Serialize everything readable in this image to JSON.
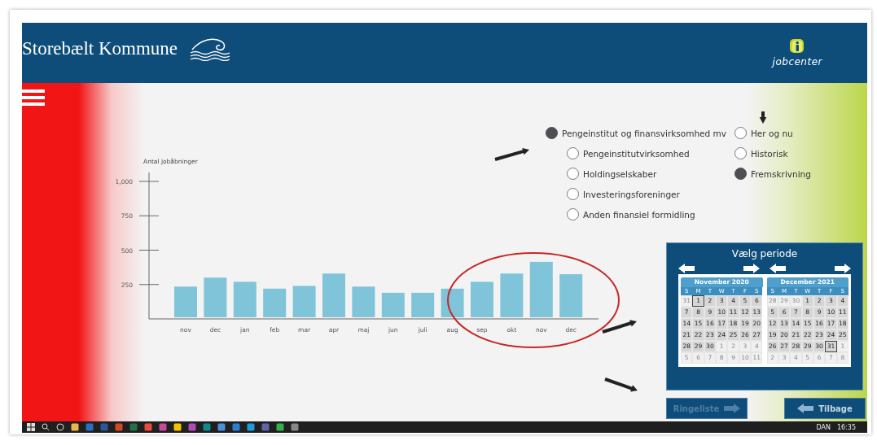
{
  "header": {
    "title": "Storebælt Kommune",
    "logo_text": "jobcenter"
  },
  "industry_options": [
    {
      "label": "Pengeinstitut og finansvirksomhed mv",
      "selected": true,
      "children": [
        {
          "label": "Pengeinstitutvirksomhed",
          "selected": false
        },
        {
          "label": "Holdingselskaber",
          "selected": false
        },
        {
          "label": "Investeringsforeninger",
          "selected": false
        },
        {
          "label": "Anden finansiel formidling",
          "selected": false
        }
      ]
    }
  ],
  "period_options": [
    {
      "label": "Her og nu",
      "selected": false
    },
    {
      "label": "Historisk",
      "selected": false
    },
    {
      "label": "Fremskrivning",
      "selected": true
    }
  ],
  "chart": {
    "chart_data": {
      "type": "bar",
      "ylabel": "Antal jobåbninger",
      "categories": [
        "nov",
        "dec",
        "jan",
        "feb",
        "mar",
        "apr",
        "maj",
        "jun",
        "juli",
        "aug",
        "sep",
        "okt",
        "nov",
        "dec"
      ],
      "values": [
        235,
        300,
        270,
        220,
        240,
        330,
        235,
        190,
        190,
        220,
        270,
        330,
        415,
        325
      ],
      "ylim": [
        0,
        1000
      ],
      "yticks": [
        {
          "value": 250,
          "label": "250"
        },
        {
          "value": 500,
          "label": "500"
        },
        {
          "value": 750,
          "label": "750"
        },
        {
          "value": 1000,
          "label": "1,000"
        }
      ]
    }
  },
  "period_picker": {
    "title": "Vælg periode",
    "calendars": [
      {
        "title": "November 2020",
        "weekdays": [
          "S",
          "M",
          "T",
          "W",
          "T",
          "F",
          "S"
        ],
        "days": [
          {
            "day": "31",
            "outside": true,
            "selected": false
          },
          {
            "day": "1",
            "outside": false,
            "selected": true
          },
          {
            "day": "2",
            "outside": false,
            "selected": false
          },
          {
            "day": "3",
            "outside": false,
            "selected": false
          },
          {
            "day": "4",
            "outside": false,
            "selected": false
          },
          {
            "day": "5",
            "outside": false,
            "selected": false
          },
          {
            "day": "6",
            "outside": false,
            "selected": false
          },
          {
            "day": "7",
            "outside": false,
            "selected": false
          },
          {
            "day": "8",
            "outside": false,
            "selected": false
          },
          {
            "day": "9",
            "outside": false,
            "selected": false
          },
          {
            "day": "10",
            "outside": false,
            "selected": false
          },
          {
            "day": "11",
            "outside": false,
            "selected": false
          },
          {
            "day": "12",
            "outside": false,
            "selected": false
          },
          {
            "day": "13",
            "outside": false,
            "selected": false
          },
          {
            "day": "14",
            "outside": false,
            "selected": false
          },
          {
            "day": "15",
            "outside": false,
            "selected": false
          },
          {
            "day": "16",
            "outside": false,
            "selected": false
          },
          {
            "day": "17",
            "outside": false,
            "selected": false
          },
          {
            "day": "18",
            "outside": false,
            "selected": false
          },
          {
            "day": "19",
            "outside": false,
            "selected": false
          },
          {
            "day": "20",
            "outside": false,
            "selected": false
          },
          {
            "day": "21",
            "outside": false,
            "selected": false
          },
          {
            "day": "22",
            "outside": false,
            "selected": false
          },
          {
            "day": "23",
            "outside": false,
            "selected": false
          },
          {
            "day": "24",
            "outside": false,
            "selected": false
          },
          {
            "day": "25",
            "outside": false,
            "selected": false
          },
          {
            "day": "26",
            "outside": false,
            "selected": false
          },
          {
            "day": "27",
            "outside": false,
            "selected": false
          },
          {
            "day": "28",
            "outside": false,
            "selected": false
          },
          {
            "day": "29",
            "outside": false,
            "selected": false
          },
          {
            "day": "30",
            "outside": false,
            "selected": false
          },
          {
            "day": "1",
            "outside": true,
            "selected": false
          },
          {
            "day": "2",
            "outside": true,
            "selected": false
          },
          {
            "day": "3",
            "outside": true,
            "selected": false
          },
          {
            "day": "4",
            "outside": true,
            "selected": false
          },
          {
            "day": "5",
            "outside": true,
            "selected": false
          },
          {
            "day": "6",
            "outside": true,
            "selected": false
          },
          {
            "day": "7",
            "outside": true,
            "selected": false
          },
          {
            "day": "8",
            "outside": true,
            "selected": false
          },
          {
            "day": "9",
            "outside": true,
            "selected": false
          },
          {
            "day": "10",
            "outside": true,
            "selected": false
          },
          {
            "day": "11",
            "outside": true,
            "selected": false
          }
        ]
      },
      {
        "title": "December 2021",
        "weekdays": [
          "S",
          "M",
          "T",
          "W",
          "T",
          "F",
          "S"
        ],
        "days": [
          {
            "day": "28",
            "outside": true,
            "selected": false
          },
          {
            "day": "29",
            "outside": true,
            "selected": false
          },
          {
            "day": "30",
            "outside": true,
            "selected": false
          },
          {
            "day": "1",
            "outside": false,
            "selected": false
          },
          {
            "day": "2",
            "outside": false,
            "selected": false
          },
          {
            "day": "3",
            "outside": false,
            "selected": false
          },
          {
            "day": "4",
            "outside": false,
            "selected": false
          },
          {
            "day": "5",
            "outside": false,
            "selected": false
          },
          {
            "day": "6",
            "outside": false,
            "selected": false
          },
          {
            "day": "7",
            "outside": false,
            "selected": false
          },
          {
            "day": "8",
            "outside": false,
            "selected": false
          },
          {
            "day": "9",
            "outside": false,
            "selected": false
          },
          {
            "day": "10",
            "outside": false,
            "selected": false
          },
          {
            "day": "11",
            "outside": false,
            "selected": false
          },
          {
            "day": "12",
            "outside": false,
            "selected": false
          },
          {
            "day": "13",
            "outside": false,
            "selected": false
          },
          {
            "day": "14",
            "outside": false,
            "selected": false
          },
          {
            "day": "15",
            "outside": false,
            "selected": false
          },
          {
            "day": "16",
            "outside": false,
            "selected": false
          },
          {
            "day": "17",
            "outside": false,
            "selected": false
          },
          {
            "day": "18",
            "outside": false,
            "selected": false
          },
          {
            "day": "19",
            "outside": false,
            "selected": false
          },
          {
            "day": "20",
            "outside": false,
            "selected": false
          },
          {
            "day": "21",
            "outside": false,
            "selected": false
          },
          {
            "day": "22",
            "outside": false,
            "selected": false
          },
          {
            "day": "23",
            "outside": false,
            "selected": false
          },
          {
            "day": "24",
            "outside": false,
            "selected": false
          },
          {
            "day": "25",
            "outside": false,
            "selected": false
          },
          {
            "day": "26",
            "outside": false,
            "selected": false
          },
          {
            "day": "27",
            "outside": false,
            "selected": false
          },
          {
            "day": "28",
            "outside": false,
            "selected": false
          },
          {
            "day": "29",
            "outside": false,
            "selected": false
          },
          {
            "day": "30",
            "outside": false,
            "selected": false
          },
          {
            "day": "31",
            "outside": false,
            "selected": true
          },
          {
            "day": "1",
            "outside": true,
            "selected": false
          },
          {
            "day": "2",
            "outside": true,
            "selected": false
          },
          {
            "day": "3",
            "outside": true,
            "selected": false
          },
          {
            "day": "4",
            "outside": true,
            "selected": false
          },
          {
            "day": "5",
            "outside": true,
            "selected": false
          },
          {
            "day": "6",
            "outside": true,
            "selected": false
          },
          {
            "day": "7",
            "outside": true,
            "selected": false
          },
          {
            "day": "8",
            "outside": true,
            "selected": false
          }
        ]
      }
    ]
  },
  "buttons": [
    {
      "label": "Ringeliste",
      "kind": "next",
      "disabled": true
    },
    {
      "label": "Tilbage",
      "kind": "back",
      "disabled": false
    }
  ],
  "taskbar": {
    "language": "DAN",
    "time": "16:35"
  }
}
